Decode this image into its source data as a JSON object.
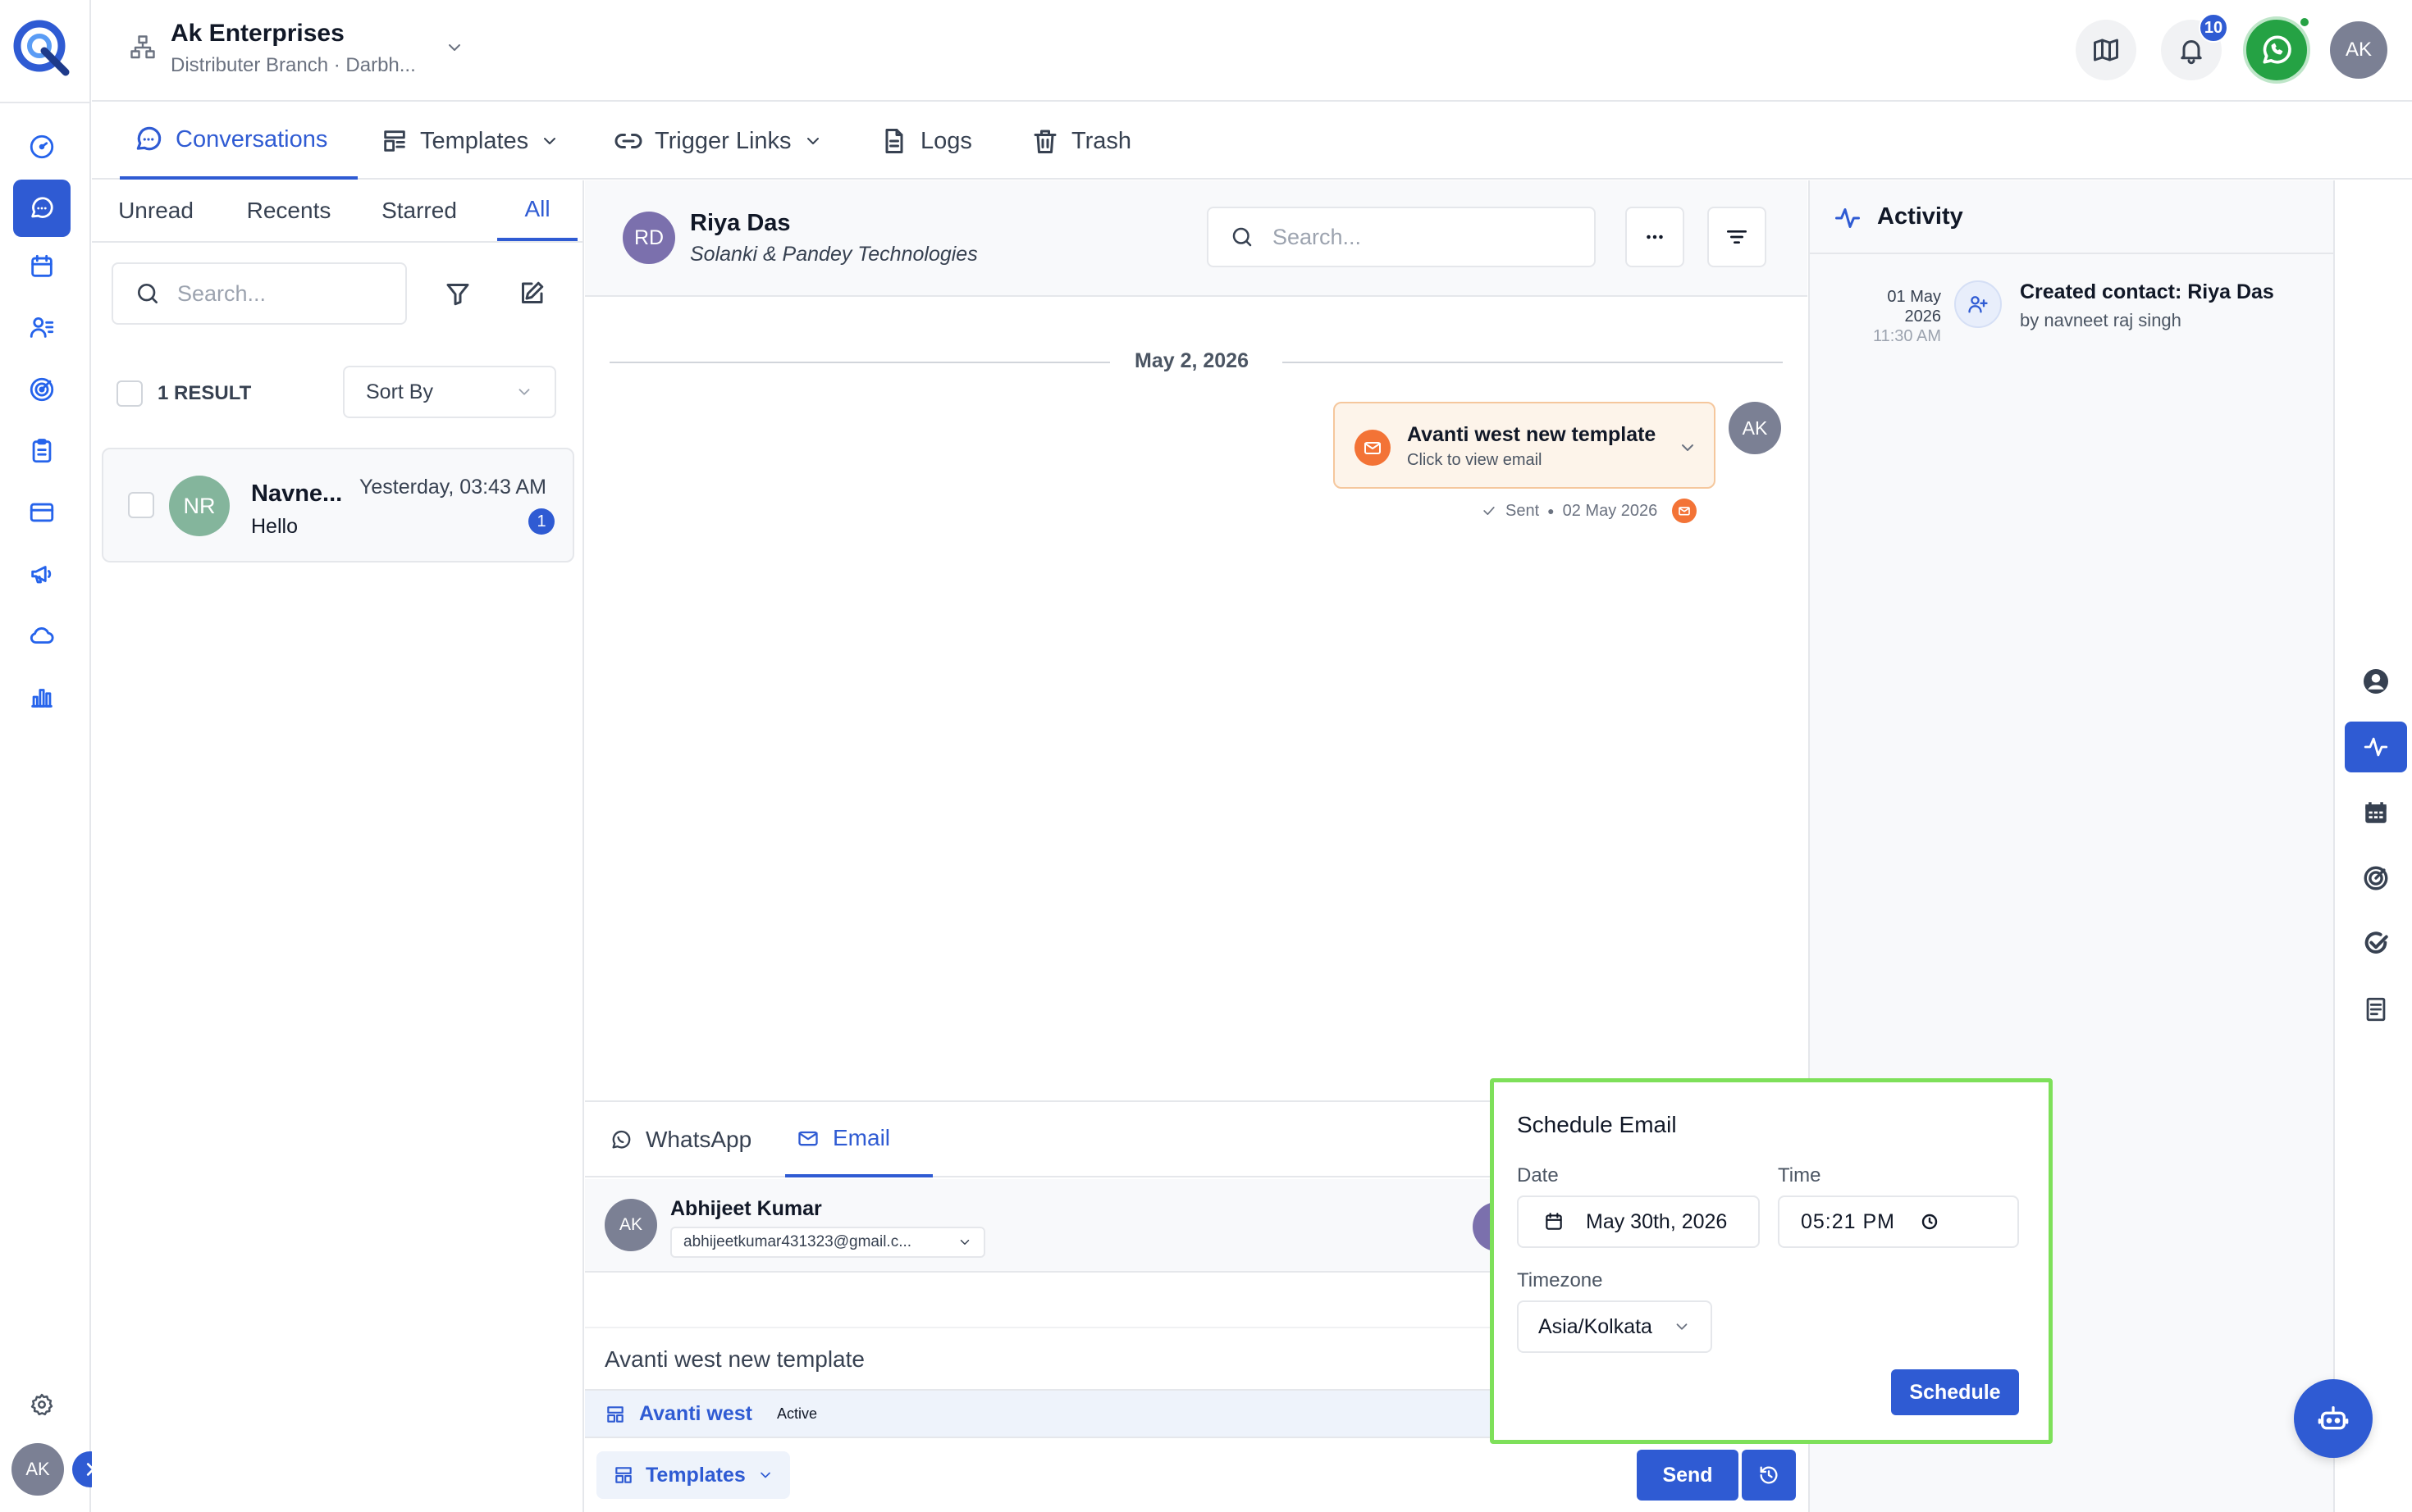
{
  "colors": {
    "accent": "#2f5bd3",
    "highlight": "#7ee05a",
    "email_orange": "#f37336",
    "whatsapp_green": "#25a244"
  },
  "org": {
    "name": "Ak Enterprises",
    "branch": "Distributer Branch · Darbh..."
  },
  "header": {
    "notification_count": "10",
    "user_initials": "AK"
  },
  "rail": {
    "icons": [
      "dashboard-icon",
      "conversations-icon",
      "calendar-icon",
      "contacts-icon",
      "target-icon",
      "clipboard-icon",
      "payments-icon",
      "megaphone-icon",
      "cloud-icon",
      "reports-icon"
    ],
    "footer_initials": "AK"
  },
  "tabs": [
    {
      "label": "Conversations"
    },
    {
      "label": "Templates"
    },
    {
      "label": "Trigger Links"
    },
    {
      "label": "Logs"
    },
    {
      "label": "Trash"
    }
  ],
  "list": {
    "filters": [
      "Unread",
      "Recents",
      "Starred",
      "All"
    ],
    "search_placeholder": "Search...",
    "result_count": "1 RESULT",
    "sort_label": "Sort By",
    "items": [
      {
        "initials": "NR",
        "name": "Navne...",
        "time": "Yesterday, 03:43 AM",
        "preview": "Hello",
        "unread": "1"
      }
    ]
  },
  "chat": {
    "contact_initials": "RD",
    "contact_name": "Riya Das",
    "company": "Solanki & Pandey Technologies",
    "search_placeholder": "Search...",
    "date_divider": "May 2, 2026",
    "message": {
      "title": "Avanti west new template",
      "subtitle": "Click to view email",
      "status": "Sent",
      "date": "02 May 2026",
      "sender_initials": "AK"
    }
  },
  "activity": {
    "title": "Activity",
    "items": [
      {
        "day": "01 May",
        "year": "2026",
        "time": "11:30 AM",
        "text": "Created contact: Riya Das",
        "by": "by navneet raj singh"
      }
    ]
  },
  "composer": {
    "tabs": [
      "WhatsApp",
      "Email"
    ],
    "from_initials": "AK",
    "from_name": "Abhijeet Kumar",
    "from_email": "abhijeetkumar431323@gmail.c...",
    "subject": "Avanti west new template",
    "template_name": "Avanti west",
    "template_status": "Active",
    "templates_button": "Templates",
    "send_button": "Send"
  },
  "schedule": {
    "title": "Schedule Email",
    "date_label": "Date",
    "date_value": "May 30th, 2026",
    "time_label": "Time",
    "time_value": "05:21 PM",
    "timezone_label": "Timezone",
    "timezone_value": "Asia/Kolkata",
    "button": "Schedule"
  }
}
